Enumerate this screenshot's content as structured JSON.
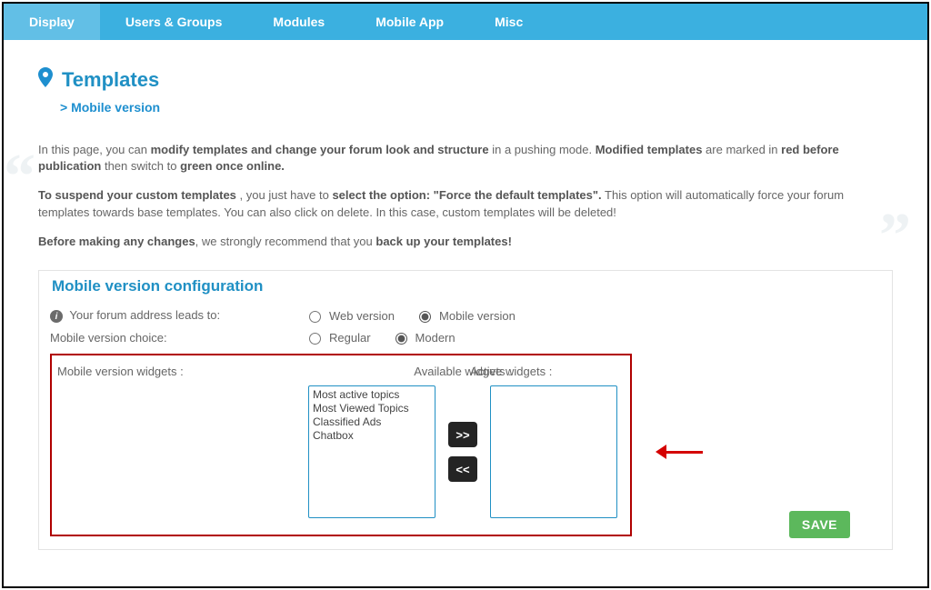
{
  "nav": {
    "tabs": [
      "Display",
      "Users & Groups",
      "Modules",
      "Mobile App",
      "Misc"
    ],
    "active": 0
  },
  "page": {
    "title": "Templates",
    "subtitle_prefix": ">",
    "subtitle": "Mobile version"
  },
  "intro": {
    "p1_a": "In this page, you can ",
    "p1_b": "modify templates and change your forum look and structure",
    "p1_c": " in a pushing mode. ",
    "p1_d": "Modified templates",
    "p1_e": " are marked in ",
    "p1_f": "red before publication",
    "p1_g": " then switch to ",
    "p1_h": "green once online.",
    "p2_a": "To suspend your custom templates",
    "p2_b": " , you just have to ",
    "p2_c": "select the option: \"Force the default templates\".",
    "p2_d": " This option will automatically force your forum templates towards base templates. You can also click on delete. In this case, custom templates will be deleted!",
    "p3_a": "Before making any changes",
    "p3_b": ", we strongly recommend that you ",
    "p3_c": "back up your templates!"
  },
  "section": {
    "title": "Mobile version configuration",
    "leads_label": "Your forum address leads to:",
    "leads_options": [
      "Web version",
      "Mobile version"
    ],
    "leads_selected": 1,
    "choice_label": "Mobile version choice:",
    "choice_options": [
      "Regular",
      "Modern"
    ],
    "choice_selected": 1,
    "widgets_label": "Mobile version widgets :",
    "available_head": "Available widgets :",
    "active_head": "Active widgets :",
    "available_items": [
      "Most active topics",
      "Most Viewed Topics",
      "Classified Ads",
      "Chatbox"
    ],
    "active_items": [],
    "move_right": ">>",
    "move_left": "<<"
  },
  "save_label": "SAVE"
}
